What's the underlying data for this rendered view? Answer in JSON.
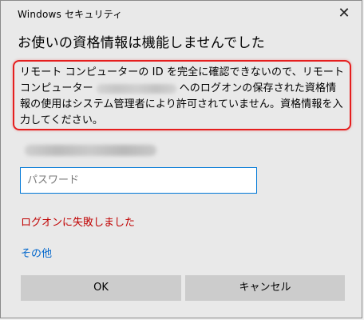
{
  "window": {
    "title": "Windows セキュリティ",
    "close_glyph": "✕"
  },
  "dialog": {
    "heading": "お使いの資格情報は機能しませんでした",
    "message_part1": "リモート コンピューターの ID を完全に確認できないので、リモート コンピューター",
    "message_part2": "へのログオンの保存された資格情報の使用はシステム管理者により許可されていません。資格情報を入力してください。"
  },
  "password": {
    "placeholder": "パスワード",
    "value": ""
  },
  "error": {
    "text": "ログオンに失敗しました"
  },
  "more_choices": {
    "label": "その他"
  },
  "buttons": {
    "ok": "OK",
    "cancel": "キャンセル"
  },
  "colors": {
    "highlight_border": "#e51e1e",
    "error": "#c00000",
    "link": "#0066cc",
    "input_focus_border": "#0078d7"
  }
}
